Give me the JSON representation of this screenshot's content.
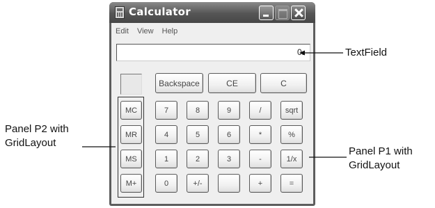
{
  "window": {
    "title": "Calculator"
  },
  "menu": [
    "Edit",
    "View",
    "Help"
  ],
  "display": {
    "value": "0."
  },
  "top_row": [
    "Backspace",
    "CE",
    "C"
  ],
  "memory_buttons": [
    "MC",
    "MR",
    "MS",
    "M+"
  ],
  "keypad_rows": [
    [
      "7",
      "8",
      "9",
      "/",
      "sqrt"
    ],
    [
      "4",
      "5",
      "6",
      "*",
      "%"
    ],
    [
      "1",
      "2",
      "3",
      "-",
      "1/x"
    ],
    [
      "0",
      "+/-",
      "",
      "+",
      "="
    ]
  ],
  "annotations": {
    "textfield": "TextField",
    "panel_p2": [
      "Panel P2 with",
      "GridLayout"
    ],
    "panel_p1": [
      "Panel P1 with",
      "GridLayout"
    ]
  }
}
